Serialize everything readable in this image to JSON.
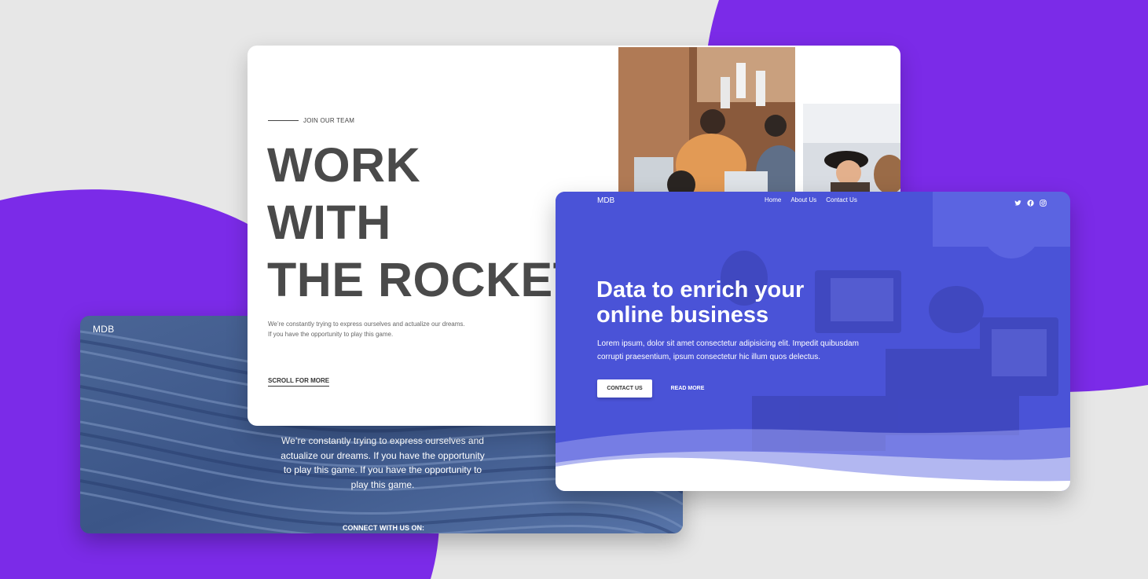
{
  "colors": {
    "background": "#e7e7e7",
    "accent_purple": "#7b2be8",
    "hero_blue": "#4b55d8",
    "headline_gray": "#4a4a4a"
  },
  "back_card": {
    "brand": "MDB",
    "paragraph": "We’re constantly trying to express ourselves and actualize our dreams. If you have the opportunity to play this game. If you have the opportunity to play this game.",
    "connect_label": "CONNECT WITH US ON:"
  },
  "middle_card": {
    "eyebrow": "JOIN OUR TEAM",
    "headline": [
      "WORK",
      "WITH",
      "THE ROCKETS"
    ],
    "subtext": [
      "We’re constantly trying to express ourselves and actualize our dreams.",
      "If you have the opportunity to play this game."
    ],
    "scroll_label": "SCROLL FOR MORE",
    "photos": [
      "team-meeting-photo",
      "friends-laughing-photo"
    ]
  },
  "front_card": {
    "brand": "MDB",
    "nav": [
      "Home",
      "About Us",
      "Contact Us"
    ],
    "social_icons": [
      "twitter-icon",
      "facebook-icon",
      "instagram-icon"
    ],
    "title": [
      "Data to enrich your",
      "online business"
    ],
    "text": [
      "Lorem ipsum, dolor sit amet consectetur adipisicing elit. Impedit quibusdam",
      "corrupti praesentium, ipsum consectetur hic illum quos delectus."
    ],
    "buttons": {
      "contact": "CONTACT US",
      "read_more": "READ MORE"
    }
  }
}
